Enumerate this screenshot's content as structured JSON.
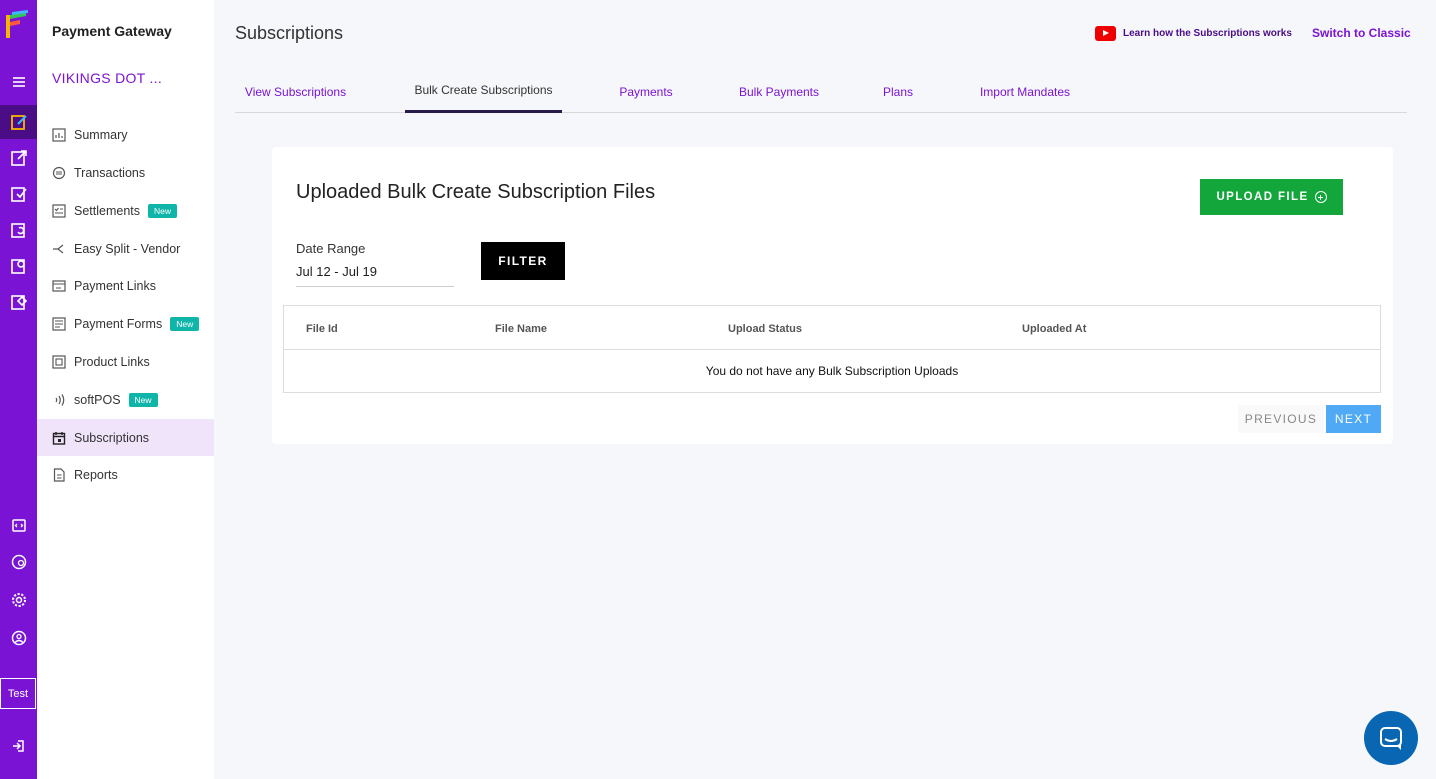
{
  "rail": {
    "test_label": "Test"
  },
  "sidebar": {
    "title": "Payment Gateway",
    "merchant": "VIKINGS DOT ...",
    "items": [
      {
        "label": "Summary",
        "icon": "bar-chart-icon"
      },
      {
        "label": "Transactions",
        "icon": "transactions-icon"
      },
      {
        "label": "Settlements",
        "icon": "settlements-icon",
        "badge": "New"
      },
      {
        "label": "Easy Split - Vendor",
        "icon": "split-icon"
      },
      {
        "label": "Payment Links",
        "icon": "payment-links-icon"
      },
      {
        "label": "Payment Forms",
        "icon": "payment-forms-icon",
        "badge": "New"
      },
      {
        "label": "Product Links",
        "icon": "product-links-icon"
      },
      {
        "label": "softPOS",
        "icon": "softpos-icon",
        "badge": "New"
      },
      {
        "label": "Subscriptions",
        "icon": "calendar-icon",
        "active": true
      },
      {
        "label": "Reports",
        "icon": "document-icon"
      }
    ]
  },
  "header": {
    "title": "Subscriptions",
    "learn_link": "Learn how the Subscriptions works",
    "switch_link": "Switch to Classic"
  },
  "tabs": [
    {
      "label": "View Subscriptions"
    },
    {
      "label": "Bulk Create Subscriptions",
      "active": true
    },
    {
      "label": "Payments"
    },
    {
      "label": "Bulk Payments"
    },
    {
      "label": "Plans"
    },
    {
      "label": "Import Mandates"
    }
  ],
  "card": {
    "title": "Uploaded Bulk Create Subscription Files",
    "upload_label": "UPLOAD FILE",
    "date_range_label": "Date Range",
    "date_range_value": "Jul 12 - Jul 19",
    "filter_label": "FILTER",
    "table": {
      "columns": [
        "File Id",
        "File Name",
        "Upload Status",
        "Uploaded At"
      ],
      "empty_message": "You do not have any Bulk Subscription Uploads"
    },
    "pagination": {
      "previous": "PREVIOUS",
      "next": "NEXT"
    }
  },
  "colors": {
    "brand": "#7b13d4",
    "upload": "#12a63b",
    "next": "#4fa9f5",
    "badge": "#10b5a9"
  }
}
